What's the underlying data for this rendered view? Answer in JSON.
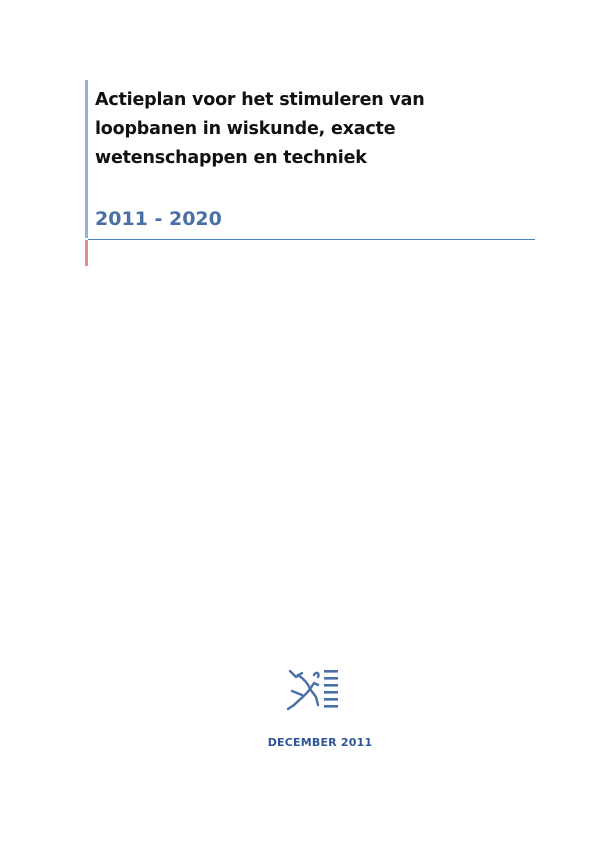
{
  "document": {
    "title": "Actieplan voor het stimuleren van loopbanen in wiskunde, exacte wetenschappen en techniek",
    "years": "2011 - 2020",
    "date": "DECEMBER 2011"
  },
  "logo": {
    "icon": "flemish-lion-logo-icon",
    "color": "#4a6fa5"
  },
  "colors": {
    "accent_blue": "#8eb1dd",
    "accent_red": "#e08e91",
    "rule": "#4f81bd",
    "years_text": "#4a6fa5",
    "date_text": "#2f5597"
  }
}
